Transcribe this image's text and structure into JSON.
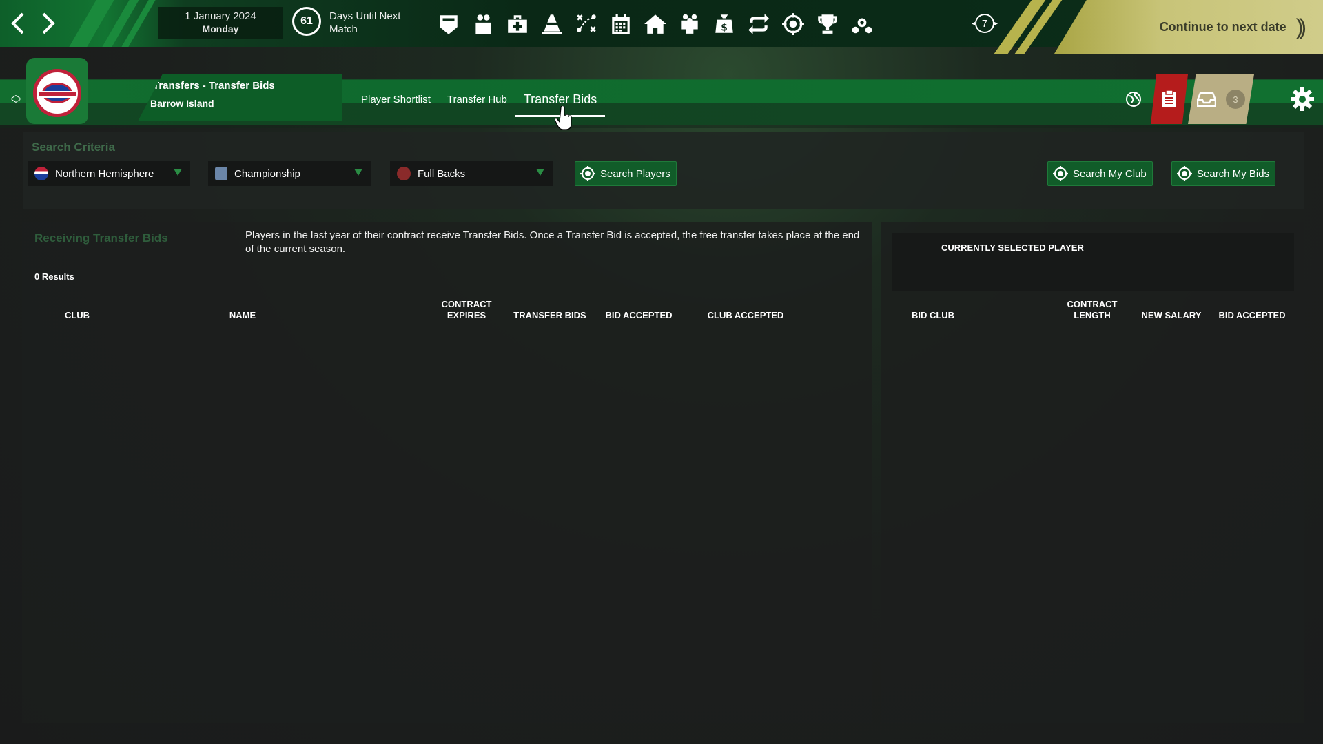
{
  "topbar": {
    "date_line1": "1 January 2024",
    "date_line2": "Monday",
    "days_until": "61",
    "days_label": "Days Until Next Match",
    "notification_count": "7",
    "continue_label": "Continue to next date",
    "icons": [
      "shield-icon",
      "people-icon",
      "medical-kit-icon",
      "training-cone-icon",
      "tactics-icon",
      "calendar-icon",
      "home-icon",
      "squad-icon",
      "finance-icon",
      "transfer-icon",
      "target-icon",
      "trophy-icon",
      "gears-icon"
    ]
  },
  "header": {
    "screen_title": "Transfers - Transfer Bids",
    "club_name": "Barrow Island",
    "tabs": [
      {
        "label": "Player Shortlist"
      },
      {
        "label": "Transfer Hub"
      },
      {
        "label": "Transfer Bids"
      }
    ],
    "inbox_count": "3"
  },
  "search": {
    "title": "Search Criteria",
    "region": "Northern Hemisphere",
    "league": "Championship",
    "position": "Full Backs",
    "search_players": "Search Players",
    "search_my_club": "Search My Club",
    "search_my_bids": "Search My Bids"
  },
  "bids": {
    "title": "Receiving Transfer Bids",
    "description": "Players in the last year of their contract receive Transfer Bids.  Once a Transfer Bid is accepted, the free transfer takes place at the end of the current season.",
    "results": "0 Results",
    "columns": {
      "club": "CLUB",
      "name": "NAME",
      "contract_expires": "CONTRACT EXPIRES",
      "transfer_bids": "TRANSFER BIDS",
      "bid_accepted": "BID ACCEPTED",
      "club_accepted": "CLUB ACCEPTED"
    }
  },
  "selected": {
    "title": "CURRENTLY SELECTED PLAYER",
    "columns": {
      "bid_club": "BID CLUB",
      "contract_length": "CONTRACT LENGTH",
      "new_salary": "NEW SALARY",
      "bid_accepted": "BID ACCEPTED"
    }
  },
  "colors": {
    "accent_green": "#115c29",
    "continue_yellow": "#c8c478",
    "alert_red": "#b51c1c"
  }
}
